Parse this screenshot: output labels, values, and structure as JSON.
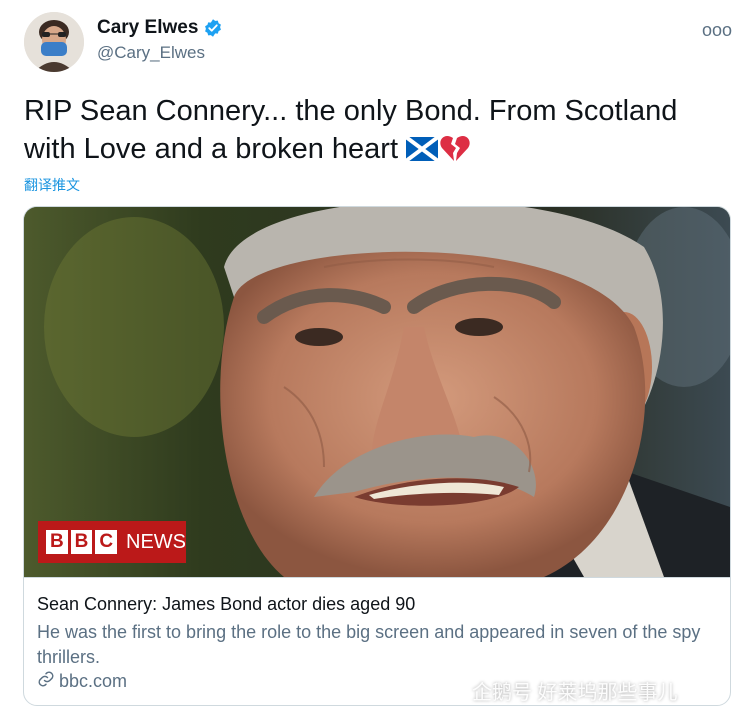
{
  "author": {
    "display_name": "Cary Elwes",
    "handle": "@Cary_Elwes",
    "verified": true
  },
  "more_button": "ooo",
  "tweet": {
    "text": "RIP Sean Connery... the only Bond. From Scotland with Love and a broken heart",
    "emojis": [
      "scotland-flag",
      "broken-heart"
    ],
    "translate_label": "翻译推文"
  },
  "card": {
    "image_overlay": {
      "letters": [
        "B",
        "B",
        "C"
      ],
      "news_label": "NEWS"
    },
    "title": "Sean Connery: James Bond actor dies aged 90",
    "description": "He was the first to bring the role to the big screen and appeared in seven of the spy thrillers.",
    "domain": "bbc.com"
  },
  "watermark": {
    "text": "企鹅号 好莱坞那些事儿"
  },
  "colors": {
    "link_blue": "#1b95e0",
    "secondary_text": "#5b7083",
    "verified_blue": "#1da1f2",
    "bbc_red": "#bb1919",
    "flag_blue": "#005eb8",
    "heart_red": "#dd2e44"
  }
}
